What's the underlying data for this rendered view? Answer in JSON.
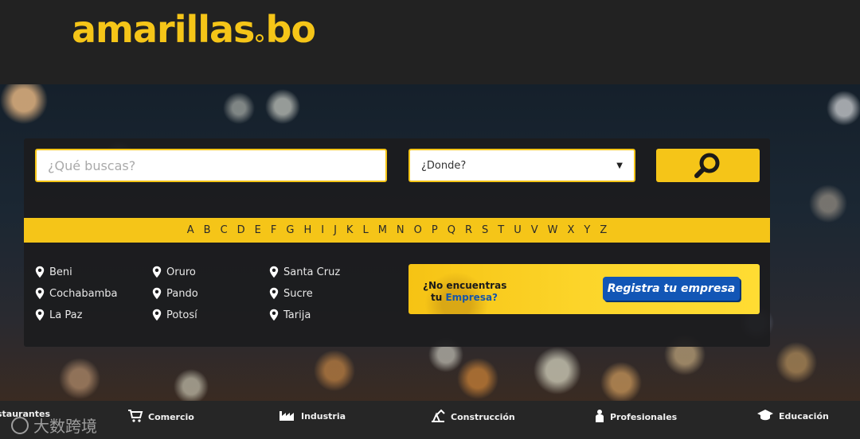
{
  "header": {
    "logo_left": "amarillas",
    "logo_right": "bo"
  },
  "search": {
    "what_placeholder": "¿Qué buscas?",
    "where_value": "¿Donde?"
  },
  "alphabet": [
    "A",
    "B",
    "C",
    "D",
    "E",
    "F",
    "G",
    "H",
    "I",
    "J",
    "K",
    "L",
    "M",
    "N",
    "O",
    "P",
    "Q",
    "R",
    "S",
    "T",
    "U",
    "V",
    "W",
    "X",
    "Y",
    "Z"
  ],
  "cities": [
    "Beni",
    "Cochabamba",
    "La Paz",
    "Oruro",
    "Pando",
    "Potosí",
    "Santa Cruz",
    "Sucre",
    "Tarija"
  ],
  "promo": {
    "line1": "¿No encuentras",
    "line2_prefix": "tu ",
    "line2_highlight": "Empresa?",
    "button": "Registra tu empresa"
  },
  "categories": [
    {
      "label": "staurantes",
      "icon": "restaurant-icon"
    },
    {
      "label": "Comercio",
      "icon": "cart-icon"
    },
    {
      "label": "Industria",
      "icon": "factory-icon"
    },
    {
      "label": "Construcción",
      "icon": "construction-icon"
    },
    {
      "label": "Profesionales",
      "icon": "professional-icon"
    },
    {
      "label": "Educación",
      "icon": "graduation-cap-icon"
    }
  ],
  "watermark": "大数跨境",
  "colors": {
    "brand_yellow": "#f5c518",
    "header_bg": "#222222",
    "panel_bg": "#1c1c1e",
    "register_blue": "#1256b6",
    "highlight_blue": "#1656a8"
  }
}
